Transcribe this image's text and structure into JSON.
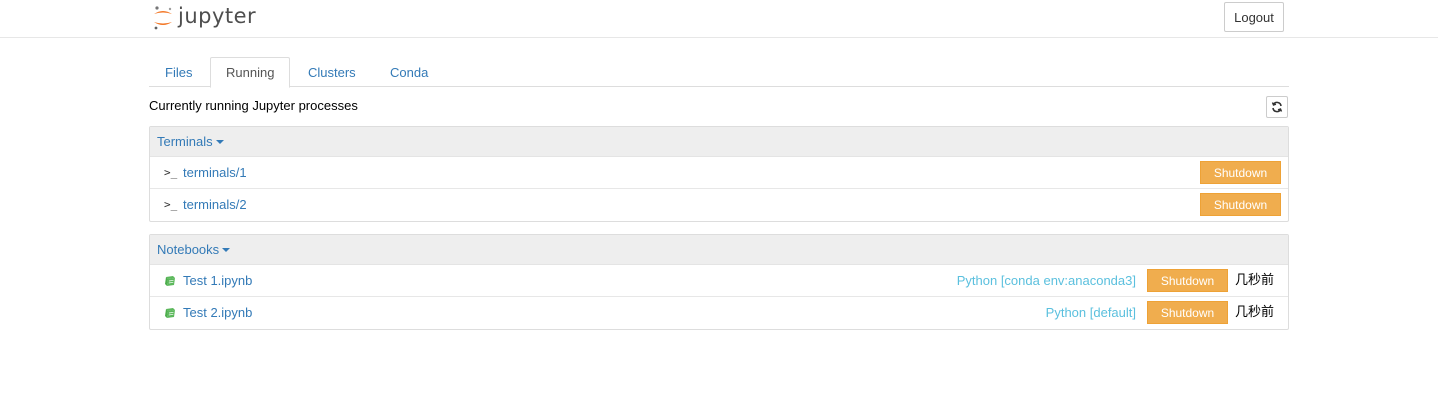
{
  "header": {
    "logo_text": "jupyter",
    "logout_label": "Logout"
  },
  "tabs": [
    {
      "label": "Files"
    },
    {
      "label": "Running"
    },
    {
      "label": "Clusters"
    },
    {
      "label": "Conda"
    }
  ],
  "running": {
    "title": "Currently running Jupyter processes",
    "terminals": {
      "heading": "Terminals",
      "items": [
        {
          "name": "terminals/1",
          "shutdown_label": "Shutdown"
        },
        {
          "name": "terminals/2",
          "shutdown_label": "Shutdown"
        }
      ]
    },
    "notebooks": {
      "heading": "Notebooks",
      "items": [
        {
          "name": "Test 1.ipynb",
          "kernel": "Python [conda env:anaconda3]",
          "shutdown_label": "Shutdown",
          "time": "几秒前"
        },
        {
          "name": "Test 2.ipynb",
          "kernel": "Python [default]",
          "shutdown_label": "Shutdown",
          "time": "几秒前"
        }
      ]
    }
  },
  "colors": {
    "link": "#337ab7",
    "shutdown": "#f0ad4e",
    "kernel": "#5bc0de",
    "notebook_icon": "#5cb85c",
    "logo_orange": "#f37726"
  },
  "icons": {
    "terminal": "terminal-icon",
    "notebook": "notebook-icon",
    "refresh": "refresh-icon"
  }
}
